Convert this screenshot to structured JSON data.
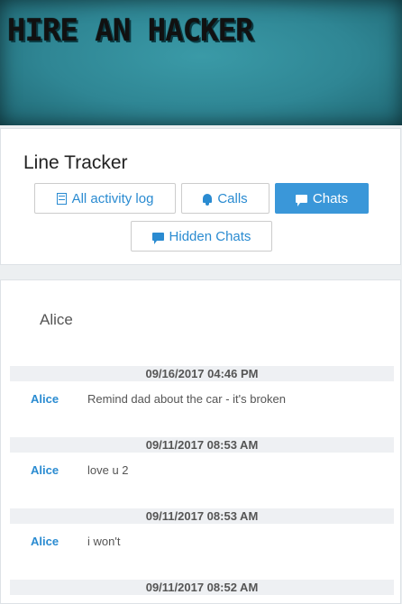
{
  "header": {
    "banner_title": "HIRE AN HACKER"
  },
  "tracker": {
    "title": "Line Tracker",
    "buttons": {
      "activity": {
        "label": "All activity log",
        "icon": "log-icon"
      },
      "calls": {
        "label": "Calls",
        "icon": "bell-icon"
      },
      "chats": {
        "label": "Chats",
        "icon": "chat-icon",
        "active": true
      },
      "hidden": {
        "label": "Hidden Chats",
        "icon": "chat-icon"
      }
    }
  },
  "chat": {
    "contact": "Alice",
    "messages": [
      {
        "date": "09/16/2017 04:46 PM",
        "sender": "Alice",
        "text": "Remind dad about the car - it's broken"
      },
      {
        "date": "09/11/2017 08:53 AM",
        "sender": "Alice",
        "text": "love u 2"
      },
      {
        "date": "09/11/2017 08:53 AM",
        "sender": "Alice",
        "text": "i won't"
      },
      {
        "date": "09/11/2017 08:52 AM",
        "sender": "",
        "text": ""
      }
    ]
  },
  "colors": {
    "accent": "#3a97d9",
    "link": "#2a8bd1",
    "banner": "#2f8694"
  }
}
